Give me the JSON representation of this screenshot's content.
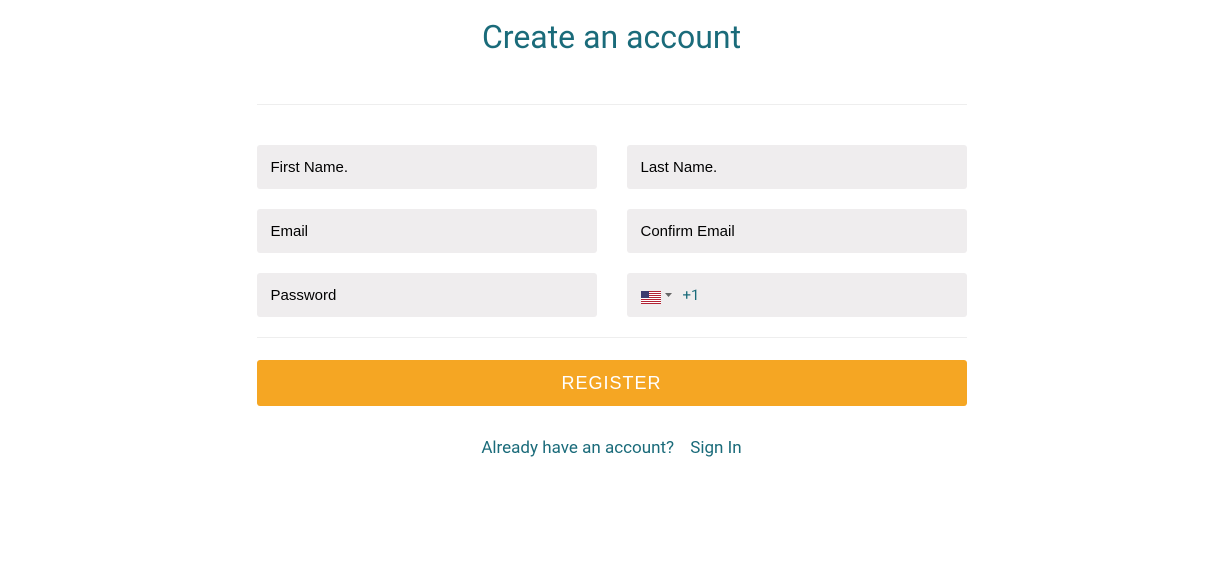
{
  "title": "Create an account",
  "form": {
    "first_name": {
      "placeholder": "First Name."
    },
    "last_name": {
      "placeholder": "Last Name."
    },
    "email": {
      "placeholder": "Email"
    },
    "confirm_email": {
      "placeholder": "Confirm Email"
    },
    "password": {
      "placeholder": "Password"
    },
    "phone": {
      "dial_code": "+1",
      "country": "US"
    }
  },
  "register_label": "REGISTER",
  "signin_prompt": "Already have an account?",
  "signin_link": "Sign In"
}
